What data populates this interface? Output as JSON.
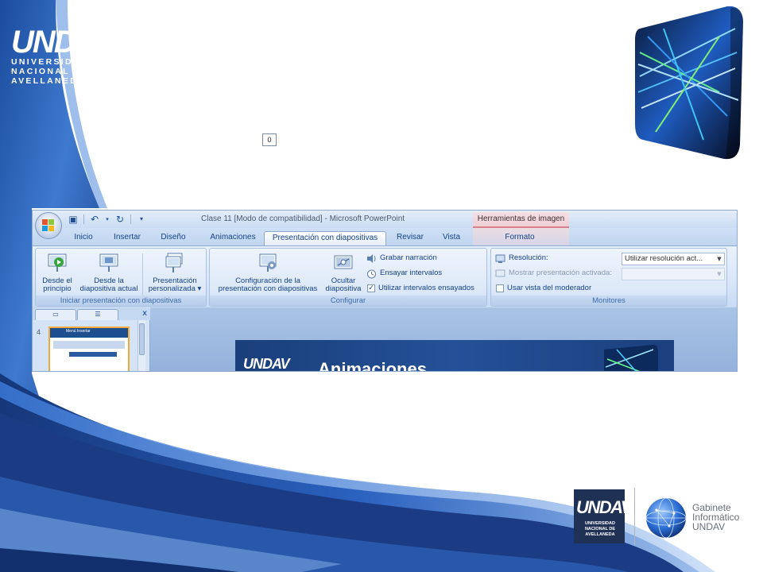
{
  "slide": {
    "logo_tl": {
      "wordmark": "UNDAV",
      "lines": [
        "UNIVERSIDAD",
        "NACIONAL DE",
        "AVELLANEDA"
      ]
    },
    "logo_br": {
      "wordmark": "UNDAV",
      "subtitle": "UNIVERSIDAD NACIONAL DE AVELLANEDA"
    },
    "gabinete": {
      "line1": "Gabinete",
      "line2": "Informático",
      "line3": "UNDAV"
    },
    "colors": {
      "accent_blue": "#1a3f7a",
      "contextual_red": "#d9808e"
    }
  },
  "ppt": {
    "window_title": "Clase 11 [Modo de compatibilidad] - Microsoft PowerPoint",
    "contextual_header": "Herramientas de imagen",
    "qat_icons": [
      "save-icon",
      "undo-icon",
      "redo-icon",
      "customize-qat-icon"
    ],
    "tabs": [
      {
        "label": "Inicio"
      },
      {
        "label": "Insertar"
      },
      {
        "label": "Diseño"
      },
      {
        "label": "Animaciones"
      },
      {
        "label": "Presentación con diapositivas"
      },
      {
        "label": "Revisar"
      },
      {
        "label": "Vista"
      },
      {
        "label": "Formato"
      }
    ],
    "active_tab": "Presentación con diapositivas",
    "groups": {
      "iniciar": {
        "label": "Iniciar presentación con diapositivas",
        "btn1": {
          "line1": "Desde el",
          "line2": "principio"
        },
        "btn2": {
          "line1": "Desde la",
          "line2": "diapositiva actual"
        },
        "btn3": {
          "line1": "Presentación",
          "line2": "personalizada ▾"
        }
      },
      "configurar": {
        "label": "Configurar",
        "btn1": {
          "line1": "Configuración de la",
          "line2": "presentación con diapositivas"
        },
        "btn2": {
          "line1": "Ocultar",
          "line2": "diapositiva"
        },
        "grabar": "Grabar narración",
        "ensayar": "Ensayar intervalos",
        "utilizar": "Utilizar intervalos ensayados",
        "utilizar_checked": "✓"
      },
      "monitores": {
        "label": "Monitores",
        "resolucion_label": "Resolución:",
        "resolucion_value": "Utilizar resolución act...",
        "mostrar_label": "Mostrar presentación activada:",
        "mostrar_value": "",
        "moderador": "Usar vista del moderador"
      }
    },
    "panel": {
      "close": "x",
      "slide_number": "4",
      "thumb_title": "Menú Insertar"
    },
    "canvas": {
      "badge": "0",
      "logo": "UNDAV",
      "title": "Animaciones"
    }
  }
}
